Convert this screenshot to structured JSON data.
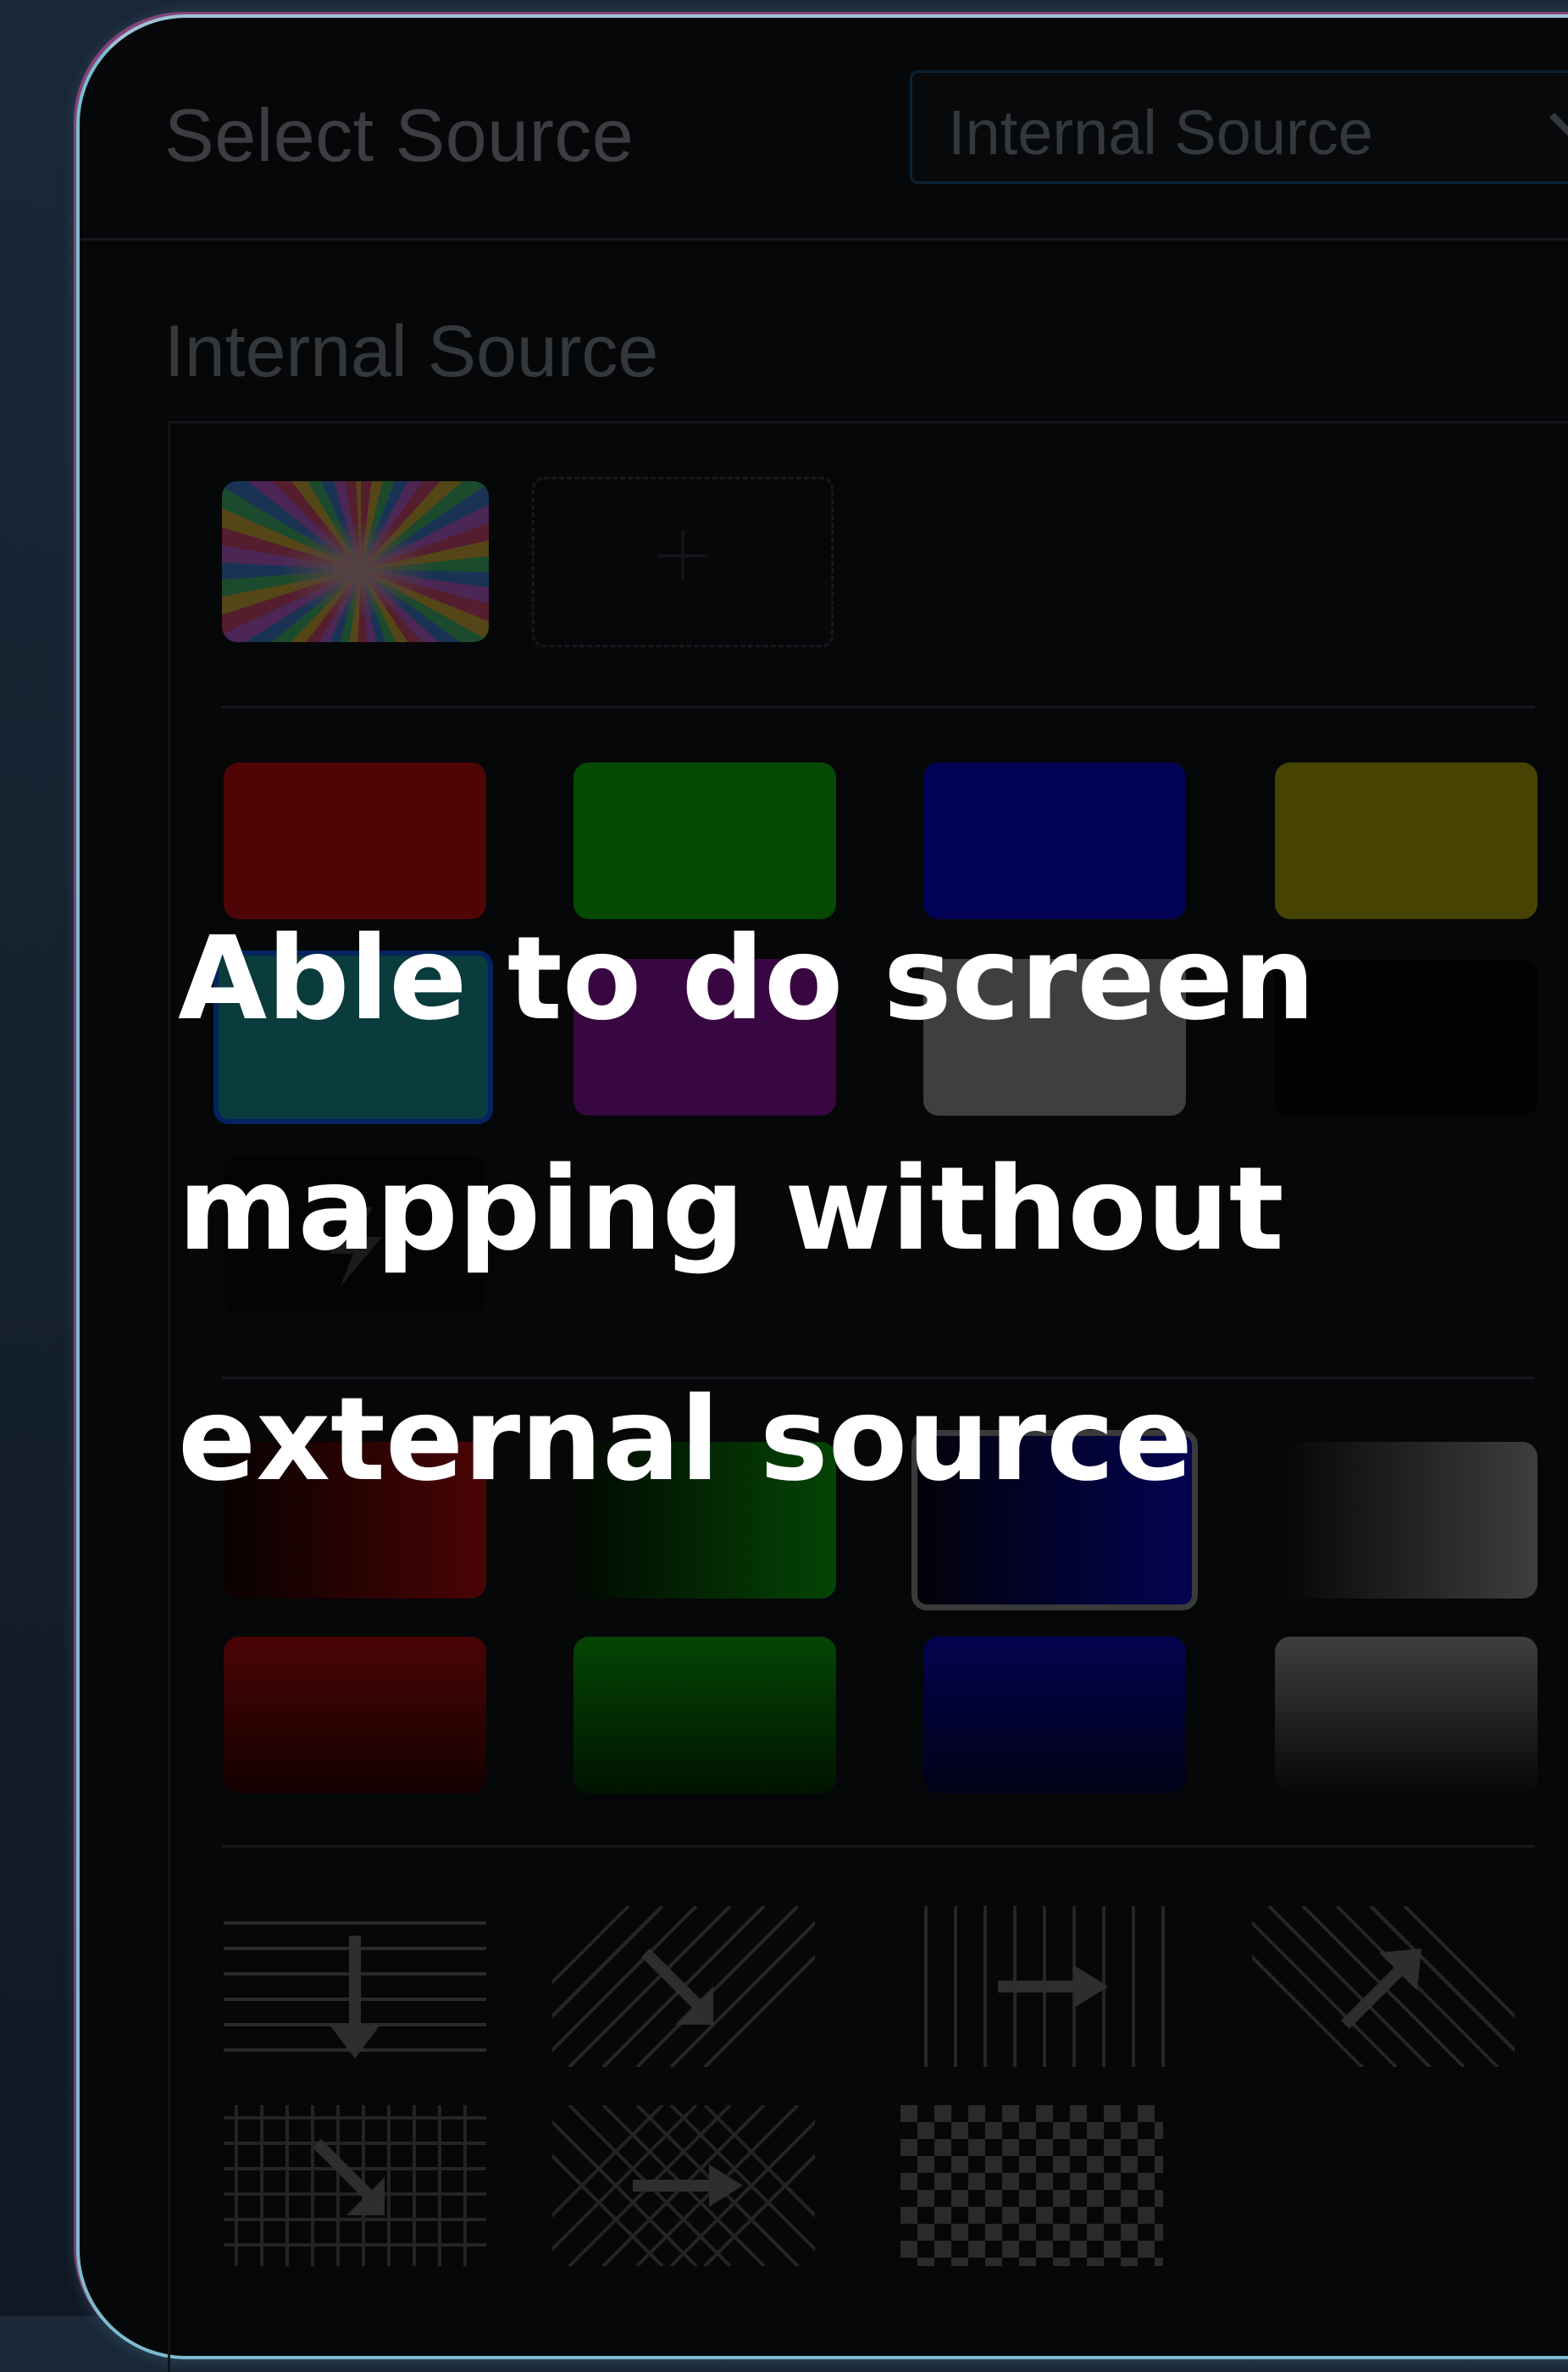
{
  "header": {
    "title": "Select Source",
    "source_select_value": "Internal Source"
  },
  "section": {
    "title": "Internal Source"
  },
  "colors": {
    "solid": [
      "#5a0404",
      "#055005",
      "#03045e",
      "#4e4a03",
      "#0a3f40",
      "#3d0845",
      "#444444",
      "#020202"
    ],
    "selected_solid": "teal",
    "gradient_row1": [
      "red",
      "green",
      "blue",
      "gray"
    ],
    "gradient_row2": [
      "red",
      "green",
      "blue",
      "gray"
    ]
  },
  "icons": {
    "rainbow_thumb": "rainbow-burst-thumbnail",
    "add": "plus-icon",
    "flash": "lightning-icon",
    "chevron": "chevron-down-icon",
    "patterns": [
      "horizontal-lines-down-arrow",
      "diagonal-lines-down-right-arrow",
      "vertical-lines-right-arrow",
      "diagonal-lines-up-right-arrow",
      "grid-down-right-arrow",
      "crosshatch-right-arrow",
      "checkerboard"
    ]
  },
  "overlay": {
    "lines": [
      "Able to do screen",
      "mapping without",
      "external source"
    ]
  }
}
